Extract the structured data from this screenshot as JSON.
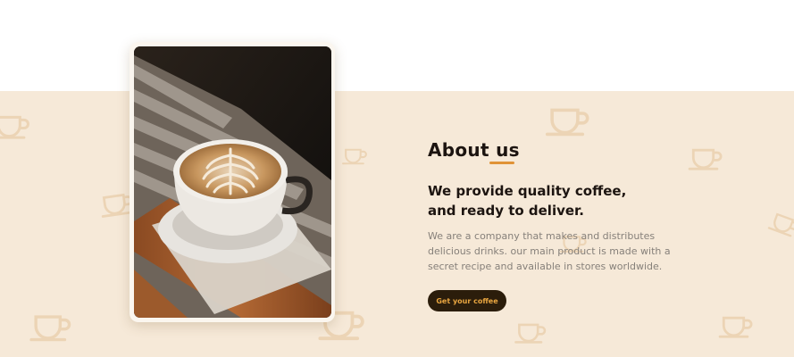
{
  "about": {
    "title": "About us",
    "subtitle_line1": "We provide quality coffee,",
    "subtitle_line2": "and ready to deliver.",
    "description": "We are a company that makes and distributes delicious drinks. our main product is made with a secret recipe and available in stores worldwide.",
    "cta_label": "Get your coffee"
  },
  "decorations": {
    "pattern_icon": "coffee-cup-icon"
  },
  "colors": {
    "band": "#f6e9d8",
    "accent": "#e09336",
    "button_bg": "#2b1d0b",
    "button_text": "#e9a640",
    "text_dark": "#1c1410",
    "text_muted": "#86807a"
  }
}
